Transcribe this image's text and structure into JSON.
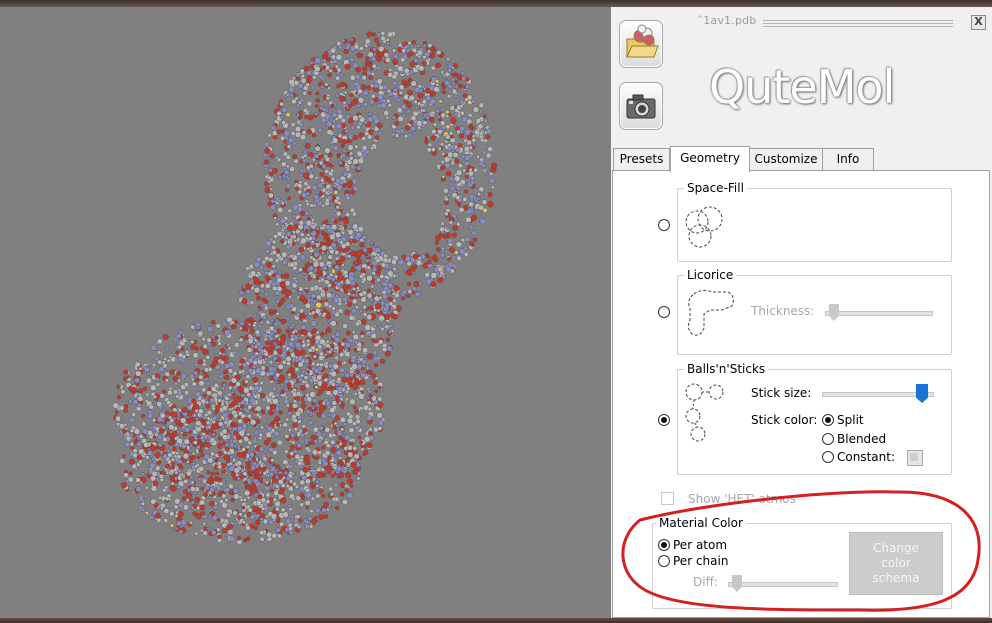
{
  "window": {
    "filename": "̂1av1.pdb",
    "logo": "QuteMol",
    "close_glyph": "X"
  },
  "toolbar": {
    "open_icon": "open-file-icon",
    "snapshot_icon": "camera-icon"
  },
  "tabs": [
    "Presets",
    "Geometry",
    "Customize",
    "Info"
  ],
  "active_tab": "Geometry",
  "geometry": {
    "space_fill": {
      "title": "Space-Fill",
      "selected": false
    },
    "licorice": {
      "title": "Licorice",
      "selected": false,
      "thickness_label": "Thickness:",
      "thickness_level": 0.0
    },
    "balls_sticks": {
      "title": "Balls'n'Sticks",
      "selected": true,
      "stick_size_label": "Stick size:",
      "stick_size_level": 1.0,
      "stick_color_label": "Stick color:",
      "options": [
        "Split",
        "Blended",
        "Constant:"
      ],
      "selected_option": "Split"
    },
    "show_het": {
      "label": "Show 'HET' atmos",
      "checked": false
    }
  },
  "material_color": {
    "title": "Material Color",
    "options": [
      "Per atom",
      "Per chain"
    ],
    "selected": "Per atom",
    "diff_label": "Diff:",
    "diff_level": 0.0,
    "change_button": "Change\ncolor\nschema"
  },
  "colors": {
    "viewport_bg": "#808080",
    "panel_bg": "#f0f0f0",
    "annotation": "#d42020",
    "slider_active": "#1a73d8",
    "atom_oxygen": "#c0392b",
    "atom_nitrogen": "#8a8cc4",
    "atom_carbon": "#b8b8b8",
    "atom_sulfur": "#e0c060"
  }
}
